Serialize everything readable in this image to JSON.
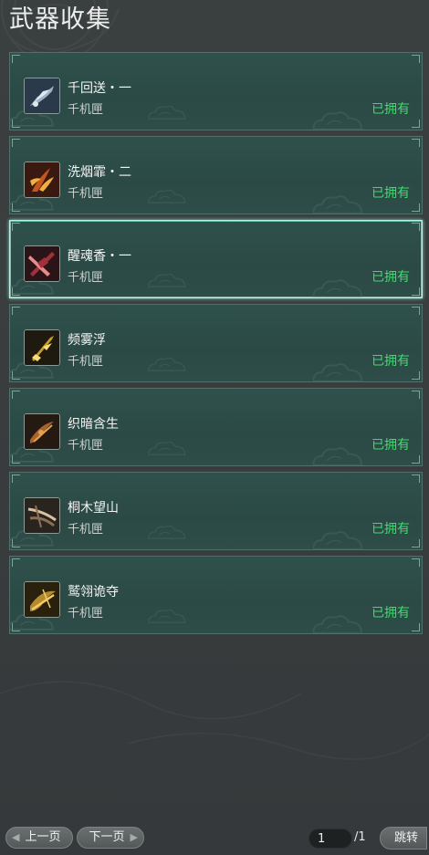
{
  "page": {
    "title": "武器收集"
  },
  "items": [
    {
      "name": "千回送・一",
      "source": "千机匣",
      "status": "已拥有",
      "icon": "weapon-silver-claw-icon",
      "palette": [
        "#2a3a4a",
        "#9fb0c4",
        "#dfe7ef"
      ]
    },
    {
      "name": "洗烟霏・二",
      "source": "千机匣",
      "status": "已拥有",
      "icon": "weapon-flame-claw-icon",
      "palette": [
        "#3a1a10",
        "#c4561f",
        "#f0b040"
      ]
    },
    {
      "name": "醒魂香・一",
      "source": "千机匣",
      "status": "已拥有",
      "icon": "weapon-crimson-blade-icon",
      "palette": [
        "#2a1418",
        "#a2303a",
        "#e88a8a"
      ]
    },
    {
      "name": "频雾浮",
      "source": "千机匣",
      "status": "已拥有",
      "icon": "weapon-golden-sword-icon",
      "palette": [
        "#1e1a10",
        "#c79a2a",
        "#f6dd7a"
      ]
    },
    {
      "name": "织暗含生",
      "source": "千机匣",
      "status": "已拥有",
      "icon": "weapon-bronze-crossbow-icon",
      "palette": [
        "#241a12",
        "#a8632a",
        "#e0a055"
      ]
    },
    {
      "name": "桐木望山",
      "source": "千机匣",
      "status": "已拥有",
      "icon": "weapon-wooden-crossbow-icon",
      "palette": [
        "#2a241e",
        "#8a6e55",
        "#d8c0a2"
      ]
    },
    {
      "name": "鹫翎诡夺",
      "source": "千机匣",
      "status": "已拥有",
      "icon": "weapon-gold-crossbow-icon",
      "palette": [
        "#2a200e",
        "#b58a2c",
        "#f0cf6a"
      ]
    }
  ],
  "selected_index": 2,
  "pagination": {
    "prev_label": "上一页",
    "next_label": "下一页",
    "current_page": "1",
    "total": "/1",
    "jump_label": "跳转"
  },
  "colors": {
    "status_owned": "#3ddc6b",
    "card_bg": "#2d4c48",
    "card_border": "#4f716a",
    "selected_border": "#bfeee0"
  }
}
